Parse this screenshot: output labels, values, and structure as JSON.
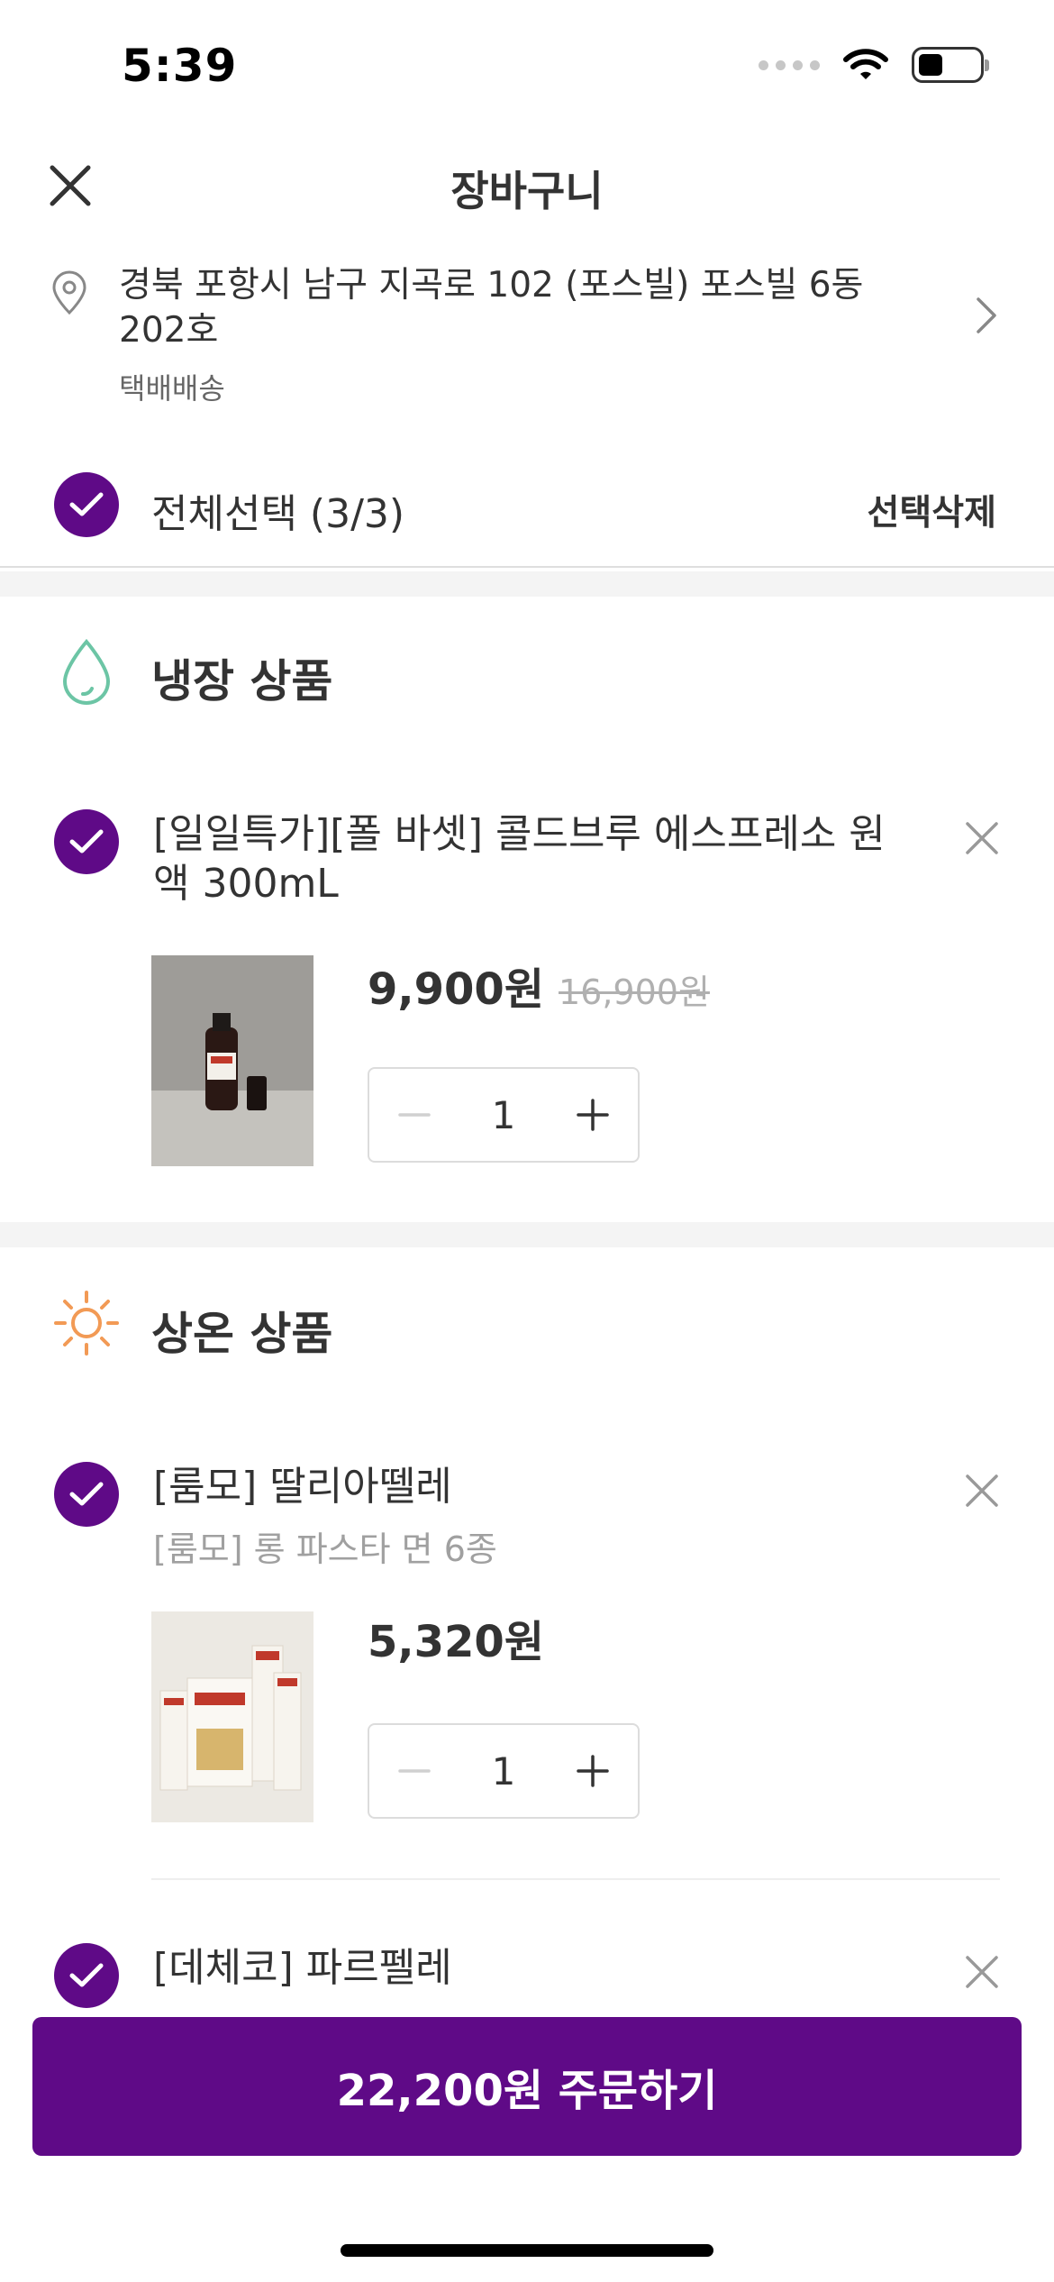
{
  "status_bar": {
    "time": "5:39"
  },
  "header": {
    "title": "장바구니"
  },
  "address": {
    "text": "경북 포항시 남구 지곡로 102 (포스빌) 포스빌 6동 202호",
    "delivery_type": "택배배송"
  },
  "selection": {
    "select_all_label": "전체선택 (3/3)",
    "delete_label": "선택삭제"
  },
  "sections": [
    {
      "title": "냉장 상품",
      "icon": "water-drop-icon",
      "items": [
        {
          "name": "[일일특가][폴 바셋] 콜드브루 에스프레소 원액 300mL",
          "price": "9,900원",
          "original_price": "16,900원",
          "quantity": "1"
        }
      ]
    },
    {
      "title": "상온 상품",
      "icon": "sun-icon",
      "items": [
        {
          "name": "[룸모] 딸리아뗄레",
          "subname": "[룸모] 롱 파스타 면 6종",
          "price": "5,320원",
          "quantity": "1"
        },
        {
          "name": "[데체코] 파르펠레"
        }
      ]
    }
  ],
  "order_button": {
    "label": "22,200원 주문하기"
  },
  "colors": {
    "brand": "#5f0a87",
    "cold_icon": "#6cc5a5",
    "ambient_icon": "#f29a55"
  }
}
